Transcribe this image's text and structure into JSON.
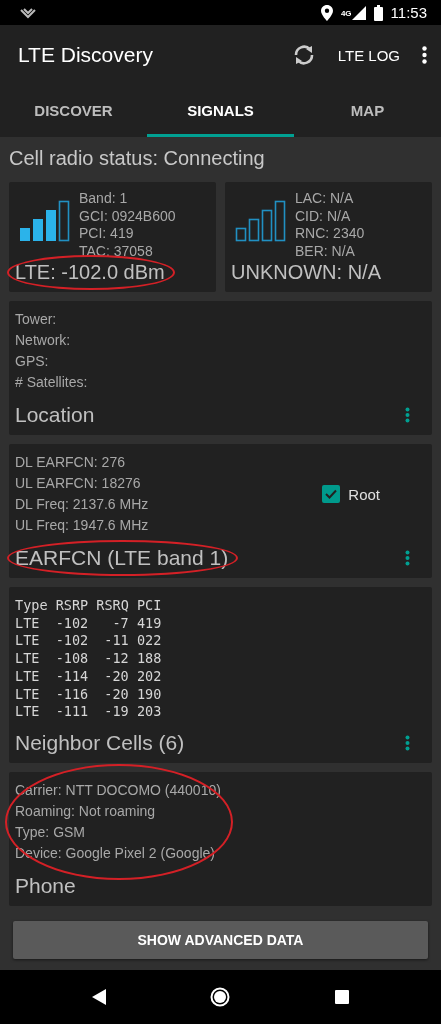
{
  "status_bar": {
    "network": "4G",
    "time": "11:53"
  },
  "app_bar": {
    "title": "LTE Discovery",
    "action": "LTE LOG"
  },
  "tabs": [
    {
      "label": "DISCOVER",
      "selected": false
    },
    {
      "label": "SIGNALS",
      "selected": true
    },
    {
      "label": "MAP",
      "selected": false
    }
  ],
  "cell_status": "Cell radio status: Connecting",
  "signal_cards": [
    {
      "kind": "lte",
      "lines": [
        "Band: 1",
        "GCI: 0924B600",
        "PCI: 419",
        "TAC: 37058"
      ],
      "value": "LTE: -102.0 dBm",
      "circled": true
    },
    {
      "kind": "unknown",
      "lines": [
        "LAC: N/A",
        "CID: N/A",
        "RNC: 2340",
        "BER: N/A"
      ],
      "value": "UNKNOWN: N/A"
    }
  ],
  "cards": [
    {
      "kind": "info",
      "lines": [
        "Tower:",
        "Network:",
        "GPS:",
        "# Satellites:"
      ],
      "title": "Location",
      "menu": true
    },
    {
      "kind": "info",
      "lines": [
        "DL EARFCN: 276",
        "UL EARFCN: 18276",
        "DL Freq: 2137.6 MHz",
        "UL Freq: 1947.6 MHz"
      ],
      "checkbox": {
        "label": "Root",
        "checked": true
      },
      "title": "EARFCN (LTE band 1)",
      "menu": true,
      "title_circled": true
    },
    {
      "kind": "table",
      "table": {
        "columns": [
          "Type",
          "RSRP",
          "RSRQ",
          "PCI"
        ],
        "rows": [
          [
            "LTE",
            "-102",
            "-7",
            "419"
          ],
          [
            "LTE",
            "-102",
            "-11",
            "022"
          ],
          [
            "LTE",
            "-108",
            "-12",
            "188"
          ],
          [
            "LTE",
            "-114",
            "-20",
            "202"
          ],
          [
            "LTE",
            "-116",
            "-20",
            "190"
          ],
          [
            "LTE",
            "-111",
            "-19",
            "203"
          ]
        ]
      },
      "title": "Neighbor Cells (6)",
      "menu": true
    },
    {
      "kind": "info",
      "lines": [
        "Carrier: NTT DOCOMO (440010)",
        "Roaming: Not roaming",
        "Type: GSM",
        "Device: Google Pixel 2 (Google)"
      ],
      "title": "Phone",
      "menu": false,
      "lines_circled": true
    }
  ],
  "button": "SHOW ADVANCED DATA"
}
